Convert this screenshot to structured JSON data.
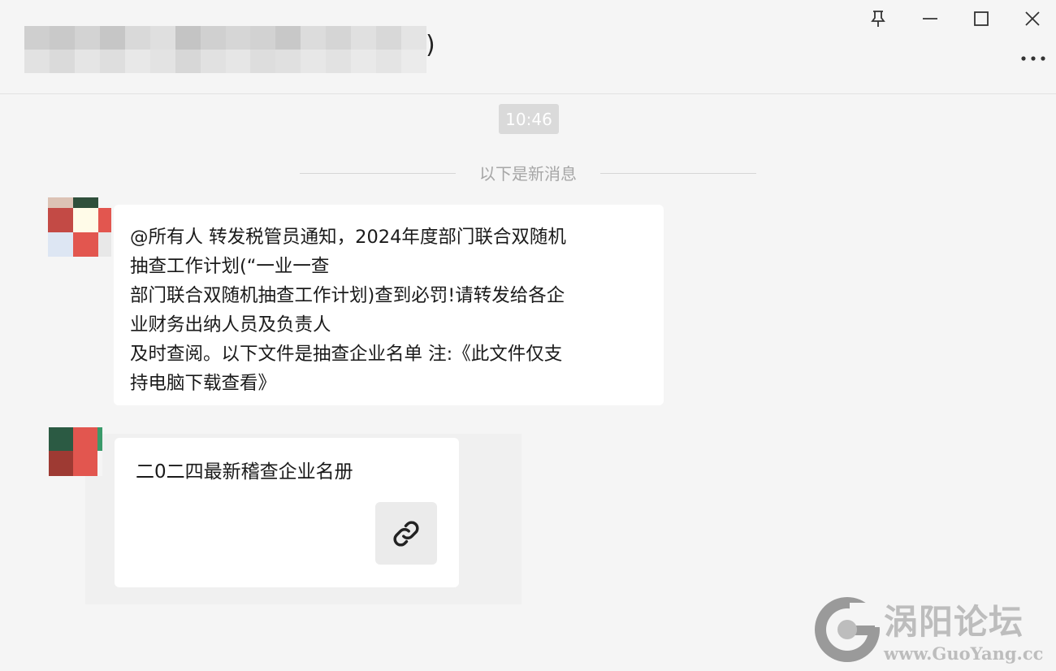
{
  "window": {
    "title_suffix": ")",
    "controls": {
      "pin_icon": "pin-icon",
      "minimize_icon": "minimize-icon",
      "maximize_icon": "maximize-icon",
      "close_icon": "close-icon",
      "more_icon": "more-icon"
    }
  },
  "chat": {
    "timestamp": "10:46",
    "new_messages_divider": "以下是新消息",
    "messages": [
      {
        "type": "text",
        "lines": [
          "@所有人 转发税管员通知，2024年度部门联合双随机",
          "抽查工作计划(“一业一查",
          "部门联合双随机抽查工作计划)查到必罚!请转发给各企",
          "业财务出纳人员及负责人",
          "及时查阅。以下文件是抽查企业名单 注:《此文件仅支",
          "持电脑下载查看》"
        ]
      },
      {
        "type": "link_card",
        "title": "二0二四最新稽查企业名册",
        "icon": "link-icon"
      }
    ]
  },
  "watermark": {
    "name": "涡阳论坛",
    "url": "www.GuoYang.cc"
  },
  "colors": {
    "background": "#f5f5f5",
    "bubble": "#ffffff",
    "timestamp_chip": "#dadada",
    "avatar_green": "#2b5a43",
    "avatar_red": "#e2564f"
  }
}
